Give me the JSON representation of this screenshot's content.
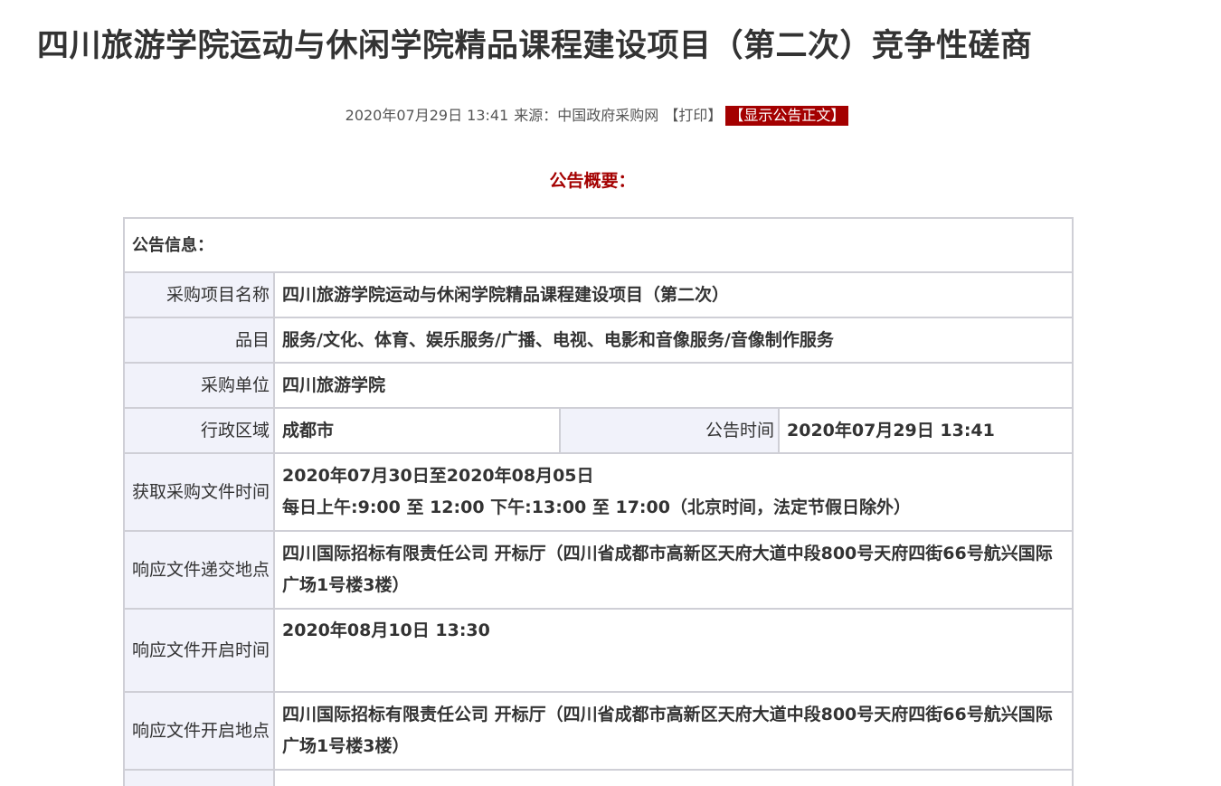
{
  "page": {
    "title": "四川旅游学院运动与休闲学院精品课程建设项目（第二次）竞争性磋商",
    "meta": {
      "datetime": "2020年07月29日 13:41",
      "source_label": "来源：",
      "source": "中国政府采购网",
      "print_label": "【打印】",
      "show_body_label": "【显示公告正文】"
    },
    "summary_heading": "公告概要："
  },
  "info_table": {
    "heading": "公告信息：",
    "project_name": {
      "label": "采购项目名称",
      "value": "四川旅游学院运动与休闲学院精品课程建设项目（第二次）"
    },
    "category": {
      "label": "品目",
      "value": "服务/文化、体育、娱乐服务/广播、电视、电影和音像服务/音像制作服务"
    },
    "purchaser": {
      "label": "采购单位",
      "value": "四川旅游学院"
    },
    "region": {
      "label": "行政区域",
      "value": "成都市"
    },
    "announce_time": {
      "label": "公告时间",
      "value": "2020年07月29日 13:41"
    },
    "doc_time": {
      "label": "获取采购文件时间",
      "value_line1": "2020年07月30日至2020年08月05日",
      "value_line2": "每日上午:9:00 至 12:00  下午:13:00 至 17:00（北京时间，法定节假日除外）"
    },
    "submit_place": {
      "label": "响应文件递交地点",
      "value": "四川国际招标有限责任公司 开标厅（四川省成都市高新区天府大道中段800号天府四街66号航兴国际广场1号楼3楼）"
    },
    "open_time": {
      "label": "响应文件开启时间",
      "value": "2020年08月10日 13:30"
    },
    "open_place": {
      "label": "响应文件开启地点",
      "value": "四川国际招标有限责任公司 开标厅（四川省成都市高新区天府大道中段800号天府四街66号航兴国际广场1号楼3楼）"
    }
  }
}
